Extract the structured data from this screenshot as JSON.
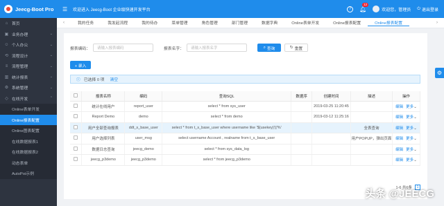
{
  "app": {
    "title": "Jeecg-Boot Pro"
  },
  "header": {
    "welcome": "欢迎进入 Jeecg-Boot 企业级快速开发平台",
    "notification_count": "12",
    "user": "欢迎您，管理员",
    "logout": "退出登录"
  },
  "sidebar": {
    "items": [
      {
        "label": "首页",
        "icon": "home-icon"
      },
      {
        "label": "业务办理",
        "icon": "briefcase-icon"
      },
      {
        "label": "个人办公",
        "icon": "user-icon"
      },
      {
        "label": "流程设计",
        "icon": "flow-icon"
      },
      {
        "label": "流程管理",
        "icon": "list-icon"
      },
      {
        "label": "统计报表",
        "icon": "chart-icon"
      },
      {
        "label": "系统管理",
        "icon": "gear-icon"
      },
      {
        "label": "在线开发",
        "icon": "code-icon"
      }
    ],
    "sub_items": [
      "Online表单开发",
      "Online报表配置",
      "Online图表配置",
      "在线数据报表1",
      "在线数据报表2",
      "动态表单",
      "AutoPoi示例"
    ]
  },
  "tabs": [
    "我的任务",
    "我发起流程",
    "我的待办",
    "菜单管理",
    "角色管理",
    "部门管理",
    "数据字典",
    "Online表单开发",
    "Online报表配置",
    "Online报表配置"
  ],
  "search": {
    "name_label": "报表编码：",
    "name_placeholder": "请输入报表编码",
    "code_label": "报表名字：",
    "code_placeholder": "请输入报表名字",
    "query": "查询",
    "reset": "重置"
  },
  "toolbar": {
    "add": "+ 录入"
  },
  "selection": {
    "text": "已选择 0 项",
    "clear": "清空"
  },
  "table": {
    "headers": [
      "报表名称",
      "编码",
      "查询SQL",
      "数据序",
      "创建时间",
      "描述",
      "操作"
    ],
    "rows": [
      {
        "name": "统计在线用户",
        "code": "report_user",
        "sql": "select * from sys_user",
        "order": "",
        "time": "2019-03-25 11:20:45",
        "desc": "",
        "edit": "编辑",
        "more": "更多"
      },
      {
        "name": "Report Demo",
        "code": "demo",
        "sql": "select * from demo",
        "order": "",
        "time": "2019-03-12 11:25:16",
        "desc": "",
        "edit": "编辑",
        "more": "更多"
      },
      {
        "name": "用户全部查询报表",
        "code": "ddt_s_base_user",
        "sql": "select * from t_s_base_user where username like '${usekey}'||'%'",
        "order": "",
        "time": "",
        "desc": "全表查询",
        "edit": "编辑",
        "more": "更多"
      },
      {
        "name": "用户选择列表",
        "code": "user_msg",
        "sql": "select username Account , realname from t_s_base_user",
        "order": "",
        "time": "",
        "desc": "用户POPUP，弹出页面",
        "edit": "编辑",
        "more": "更多"
      },
      {
        "name": "数据日志查询",
        "code": "jeecg_demo",
        "sql": "select * from sys_data_log",
        "order": "",
        "time": "",
        "desc": "",
        "edit": "编辑",
        "more": "更多"
      },
      {
        "name": "jeecg_p3demo",
        "code": "jeecg_p3demo",
        "sql": "select * from jeecg_p3demo",
        "order": "",
        "time": "",
        "desc": "",
        "edit": "编辑",
        "more": "更多"
      }
    ]
  },
  "pagination": {
    "summary": "1-6 共6条",
    "page": "1"
  },
  "watermark": {
    "text": "头条 @JEECG"
  },
  "colors": {
    "primary": "#1f8ceb",
    "sidebar_bg": "#2e3440",
    "highlight_row": "#e6f3fd"
  }
}
